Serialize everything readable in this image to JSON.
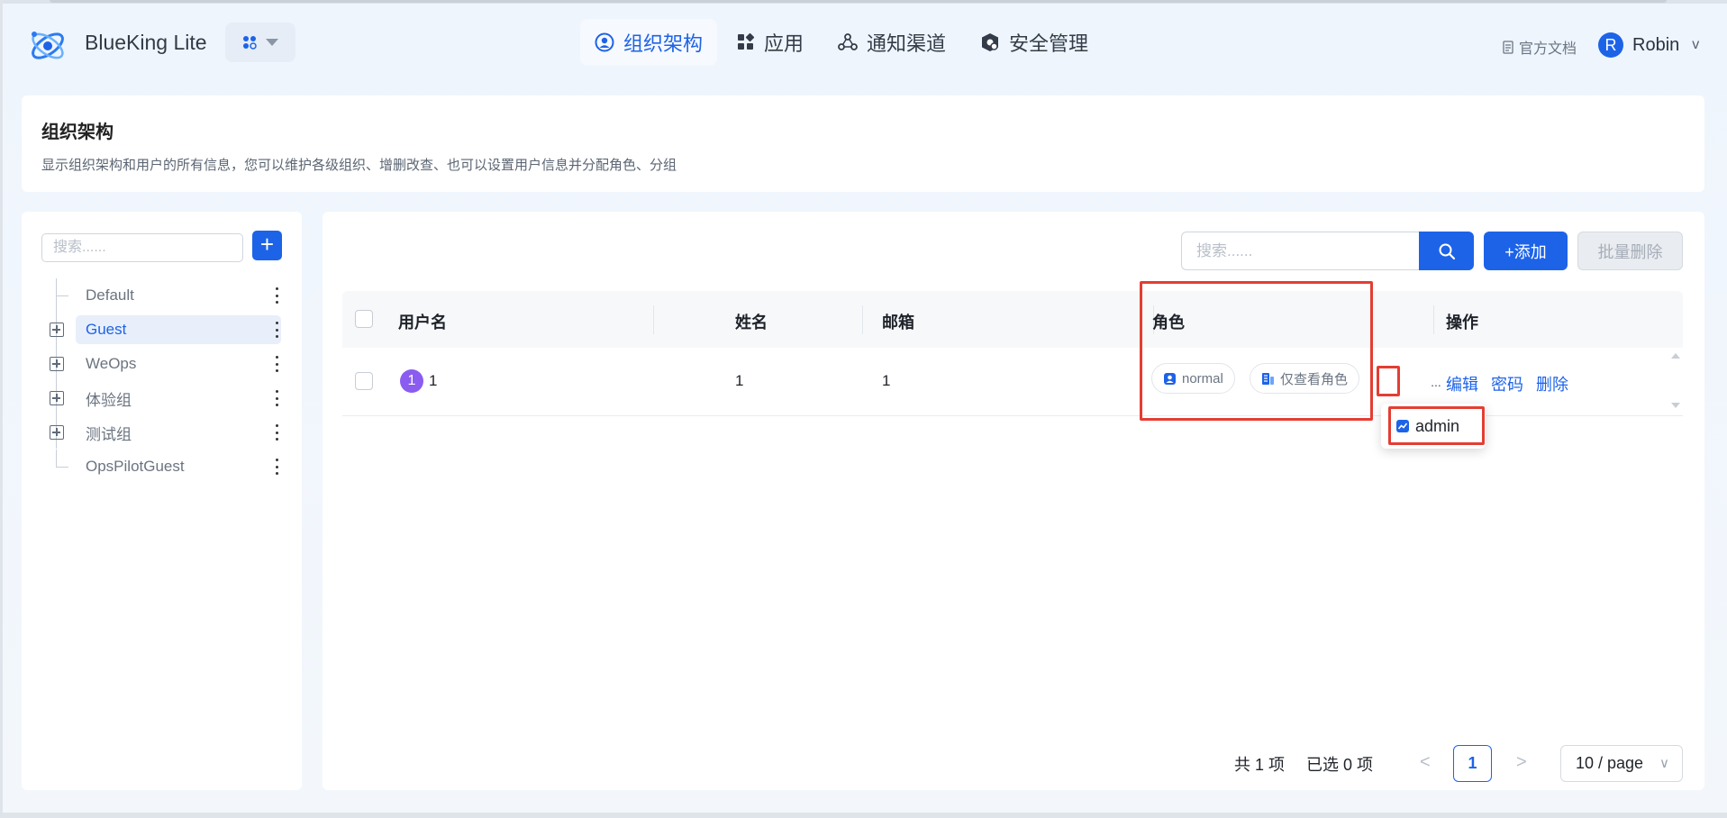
{
  "header": {
    "brand": "BlueKing Lite",
    "nav": [
      {
        "label": "组织架构",
        "icon": "user-circle-icon",
        "active": true
      },
      {
        "label": "应用",
        "icon": "apps-grid-icon",
        "active": false
      },
      {
        "label": "通知渠道",
        "icon": "share-nodes-icon",
        "active": false
      },
      {
        "label": "安全管理",
        "icon": "shield-gear-icon",
        "active": false
      }
    ],
    "docs_label": "官方文档",
    "user_initial": "R",
    "user_name": "Robin",
    "user_chevron": "v"
  },
  "title_card": {
    "title": "组织架构",
    "description": "显示组织架构和用户的所有信息，您可以维护各级组织、增删改查、也可以设置用户信息并分配角色、分组"
  },
  "tree": {
    "search_placeholder": "搜索......",
    "add_label": "+",
    "items": [
      {
        "label": "Default",
        "expandable": false,
        "selected": false
      },
      {
        "label": "Guest",
        "expandable": true,
        "selected": true
      },
      {
        "label": "WeOps",
        "expandable": true,
        "selected": false
      },
      {
        "label": "体验组",
        "expandable": true,
        "selected": false
      },
      {
        "label": "测试组",
        "expandable": true,
        "selected": false
      },
      {
        "label": "OpsPilotGuest",
        "expandable": false,
        "selected": false
      }
    ]
  },
  "toolbar": {
    "search_placeholder": "搜索......",
    "add_label": "+添加",
    "batch_delete_label": "批量删除"
  },
  "table": {
    "columns": [
      "用户名",
      "姓名",
      "邮箱",
      "角色",
      "操作"
    ],
    "rows": [
      {
        "badge": "1",
        "username": "1",
        "name": "1",
        "email": "1",
        "roles": [
          "normal",
          "仅查看角色"
        ],
        "more_label": "...",
        "actions": [
          "编辑",
          "密码",
          "删除"
        ]
      }
    ]
  },
  "popover": {
    "items": [
      "admin"
    ]
  },
  "pagination": {
    "total": "共 1 项",
    "selected": "已选 0 项",
    "prev": "<",
    "current_page": "1",
    "next": ">",
    "page_size": "10 / page"
  },
  "colors": {
    "primary": "#1d63e8",
    "highlight": "#e43d33",
    "badge": "#8a5cf0"
  }
}
